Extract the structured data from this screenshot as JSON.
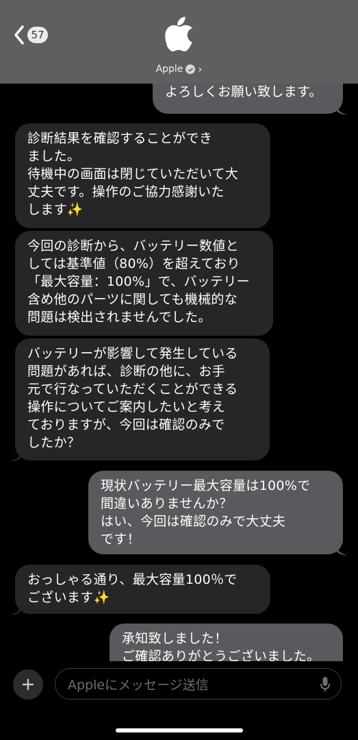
{
  "header": {
    "back_count": "57",
    "contact_name": "Apple",
    "chevron": "›"
  },
  "messages": [
    {
      "side": "out",
      "text": "可能です。\nよろしくお願い致します。"
    },
    {
      "side": "in",
      "text": "診断結果を確認することができ\nました。\n待機中の画面は閉じていただいて大\n丈夫です。操作のご協力感謝いた\nします✨"
    },
    {
      "side": "in",
      "text": "今回の診断から、バッテリー数値と\nしては基準値（80%）を超えており\n「最大容量：100%」で、バッテリー\n含め他のパーツに関しても機械的な\n問題は検出されませんでした。"
    },
    {
      "side": "in",
      "text": "バッテリーが影響して発生している\n問題があれば、診断の他に、お手\n元で行なっていただくことができる\n操作についてご案内したいと考え\nておりますが、今回は確認のみで\nしたか？"
    },
    {
      "side": "out",
      "text": "現状バッテリー最大容量は100%で\n間違いありませんか？\nはい、今回は確認のみで大丈夫\nです！"
    },
    {
      "side": "in",
      "text": "おっしゃる通り、最大容量100％で\nございます✨"
    },
    {
      "side": "out",
      "text": "承知致しました！\nご確認ありがとうございました。"
    }
  ],
  "input": {
    "placeholder": "Appleにメッセージ送信"
  },
  "icons": [
    "back-chevron-icon",
    "apple-logo-icon",
    "verified-badge-icon",
    "plus-icon",
    "microphone-icon"
  ]
}
